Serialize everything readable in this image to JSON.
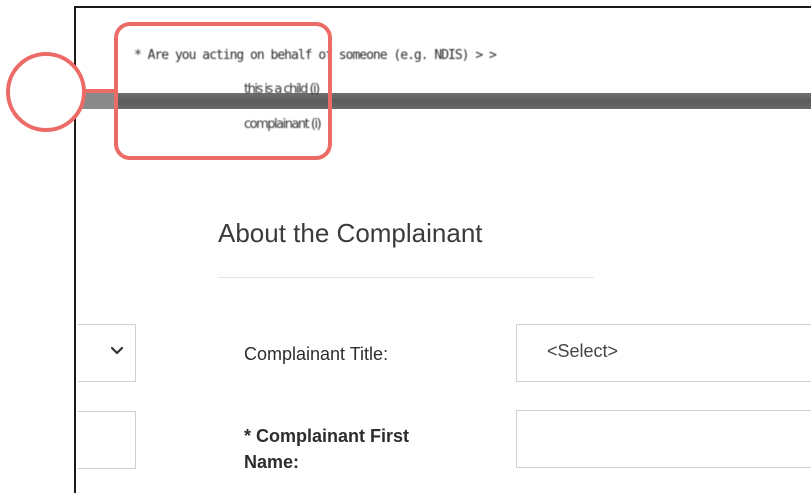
{
  "header": {
    "garbled_line": "* Are you acting on behalf of someone (e.g. NDIS) > >",
    "garbled_sub1": "this is a child (i)",
    "garbled_sub2": "complainant (i)"
  },
  "section": {
    "title": "About the Complainant"
  },
  "form": {
    "complainant_title_label": "Complainant Title:",
    "complainant_title_value": "<Select>",
    "complainant_first_name_label": "* Complainant First Name:"
  },
  "colors": {
    "annotation": "#ec6b67",
    "border": "#cfcfcf",
    "text": "#2d2d2d"
  },
  "icons": {
    "left_select": "chevron-down-icon"
  }
}
